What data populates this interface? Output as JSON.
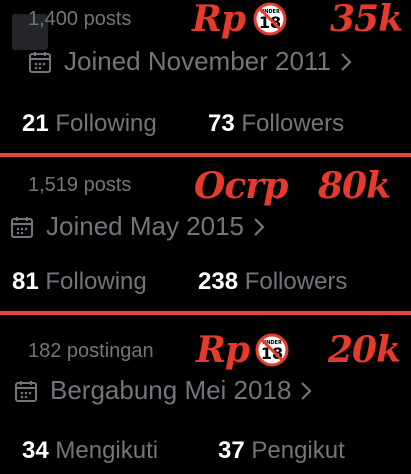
{
  "profiles": [
    {
      "posts": "1,400 posts",
      "joined": "Joined November 2011",
      "following_count": "21",
      "following_label": "Following",
      "followers_count": "73",
      "followers_label": "Followers",
      "price_prefix": "Rp",
      "price_value": "35k",
      "badge_top": "UNDER",
      "badge_number": "18"
    },
    {
      "posts": "1,519 posts",
      "joined": "Joined May 2015",
      "following_count": "81",
      "following_label": "Following",
      "followers_count": "238",
      "followers_label": "Followers",
      "price_prefix": "Ocrp",
      "price_value": "80k"
    },
    {
      "posts": "182 postingan",
      "joined": "Bergabung Mei 2018",
      "following_count": "34",
      "following_label": "Mengikuti",
      "followers_count": "37",
      "followers_label": "Pengikut",
      "price_prefix": "Rp",
      "price_value": "20k",
      "badge_top": "UNDER",
      "badge_number": "18"
    }
  ],
  "colors": {
    "price": "#e53a2c",
    "divider": "#e0463c",
    "muted_text": "#71767b",
    "bright_text": "#ffffff"
  },
  "icons": [
    "calendar-icon",
    "chevron-right-icon",
    "under-18-prohibited-icon"
  ]
}
